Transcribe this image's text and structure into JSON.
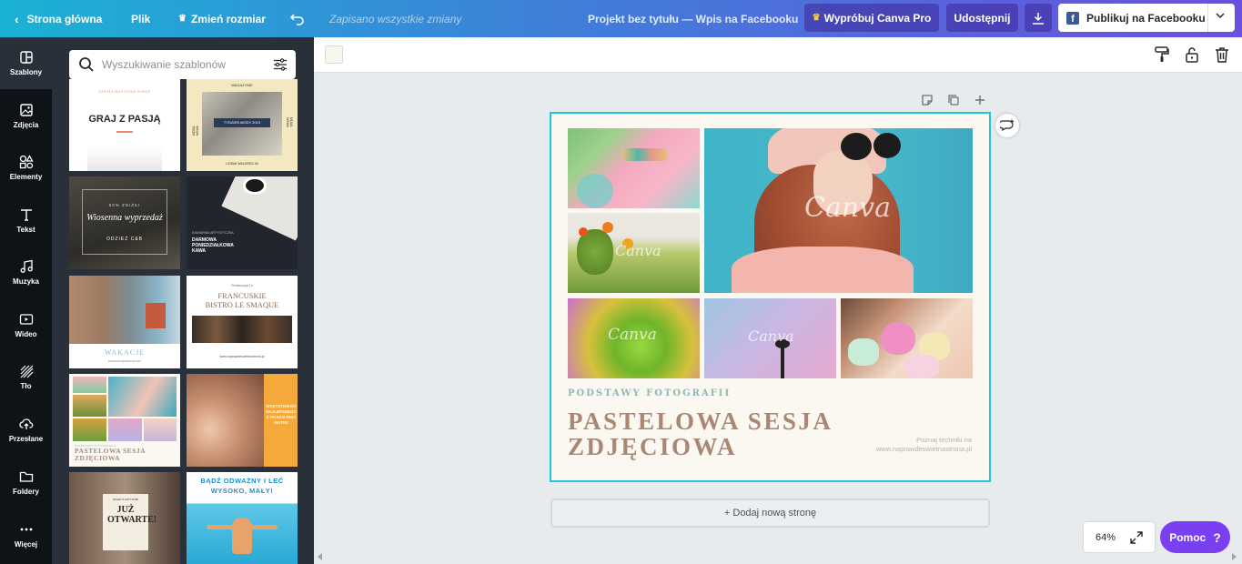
{
  "topbar": {
    "home": "Strona główna",
    "file": "Plik",
    "resize": "Zmień rozmiar",
    "saved": "Zapisano wszystkie zmiany",
    "project_title": "Projekt bez tytułu — Wpis na Facebooku",
    "try_pro": "Wypróbuj Canva Pro",
    "share": "Udostępnij",
    "publish": "Publikuj na Facebooku"
  },
  "sidenav": [
    "Szablony",
    "Zdjęcia",
    "Elementy",
    "Tekst",
    "Muzyka",
    "Wideo",
    "Tło",
    "Przesłane",
    "Foldery",
    "Więcej"
  ],
  "search": {
    "placeholder": "Wyszukiwanie szablonów"
  },
  "templates": [
    {
      "title": "GRAJ Z PASJĄ",
      "kicker": "SZKOŁA MUZYCZNA BOSSE"
    },
    {
      "title": "TYDZIEŃ MODY 2019",
      "kicker": "MAGAZYNIE",
      "side_left": "MODA NOWA",
      "side_right": "MODA NOWA",
      "footer": "LATAMI WALORES 3A"
    },
    {
      "title": "Wiosenna wyprzedaż",
      "kicker": "50% ZNIŻKI",
      "footer": "ODZIEŻ C&B"
    },
    {
      "title": "DARMOWA PONIEDZIAŁKOWA KAWA",
      "kicker": "KAWIARNIA ARTYSTYCZNA"
    },
    {
      "title": "WAKACJE",
      "footer": "www.biuropodrozy.com"
    },
    {
      "kicker": "Restauracja Le",
      "title": "FRANCUSKIE BISTRO LE SMAQUE",
      "footer": "www.naprawdeswietnastrona.pl"
    },
    {
      "kicker": "PODSTAWY FOTOGRAFII",
      "title": "PASTELOWA SESJA ZDJĘCIOWA"
    },
    {
      "title": "WSZYSTKIEGO NAJLEPSZEGO Z OKAZJI DNIA MATKI!"
    },
    {
      "title": "JUŻ OTWARTE!",
      "kicker": "SKLEP Z ANTYKAMI"
    },
    {
      "title": "BĄDŹ ODWAŻNY I LEĆ WYSOKO, MAŁY!"
    }
  ],
  "canvas": {
    "watermark": "Canva",
    "subtitle": "PODSTAWY FOTOGRAFII",
    "title_line1": "PASTELOWA SESJA",
    "title_line2": "ZDJĘCIOWA",
    "note_line1": "Poznaj techniki na",
    "note_line2": "www.naprawdeswietnastrona.pl"
  },
  "add_page": "+ Dodaj nową stronę",
  "zoom": "64%",
  "help": "Pomoc",
  "colors": {
    "accent": "#22c6da",
    "help": "#7b3ff2",
    "title": "#a98774",
    "subtitle": "#8fb8b5"
  }
}
